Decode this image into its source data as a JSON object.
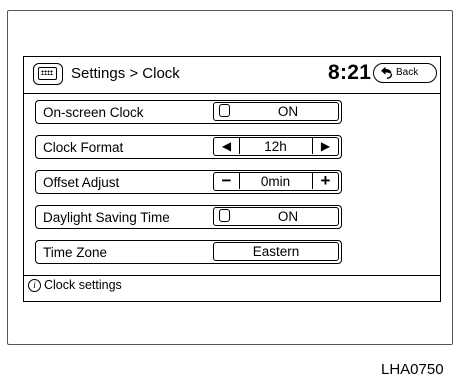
{
  "header": {
    "title": "Settings > Clock",
    "time": "8:21",
    "back_label": "Back",
    "menu_icon": "keyboard-icon",
    "back_icon": "back-arrow-icon"
  },
  "settings": {
    "onscreen_clock": {
      "label": "On-screen Clock",
      "value": "ON"
    },
    "clock_format": {
      "label": "Clock Format",
      "value": "12h",
      "left": "◀",
      "right": "▶"
    },
    "offset_adjust": {
      "label": "Offset Adjust",
      "value": "0min",
      "minus": "−",
      "plus": "+"
    },
    "daylight_saving": {
      "label": "Daylight Saving Time",
      "value": "ON"
    },
    "time_zone": {
      "label": "Time Zone",
      "value": "Eastern"
    }
  },
  "footer": {
    "icon": "info-icon",
    "info_mark": "i",
    "text": "Clock settings"
  },
  "caption": "LHA0750"
}
